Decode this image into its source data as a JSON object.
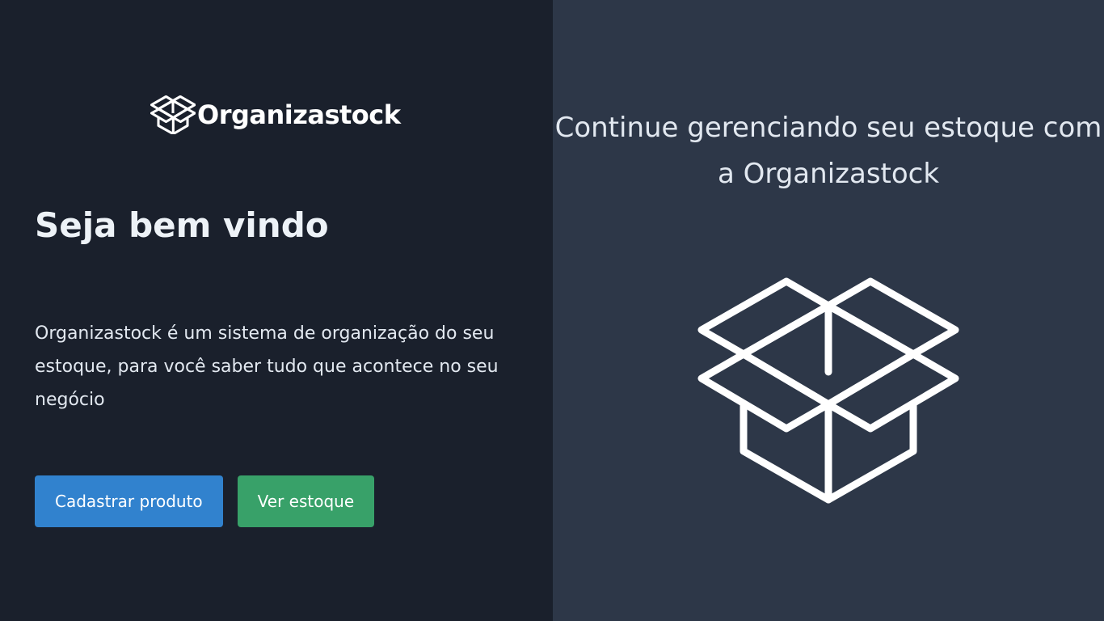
{
  "brand": {
    "name": "Organizastock",
    "icon": "open-box-icon"
  },
  "hero": {
    "welcome": "Seja bem vindo",
    "description": "Organizastock é um sistema de organização do seu estoque, para você saber tudo que acontece no seu negócio"
  },
  "actions": {
    "register_label": "Cadastrar produto",
    "view_stock_label": "Ver estoque"
  },
  "side": {
    "tagline": "Continue gerenciando seu estoque com a Organizastock",
    "illustration_icon": "open-box-icon"
  },
  "colors": {
    "left_bg": "#1a202c",
    "right_bg": "#2d3748",
    "primary": "#3182ce",
    "success": "#38a169",
    "text": "#e2e8f0"
  }
}
